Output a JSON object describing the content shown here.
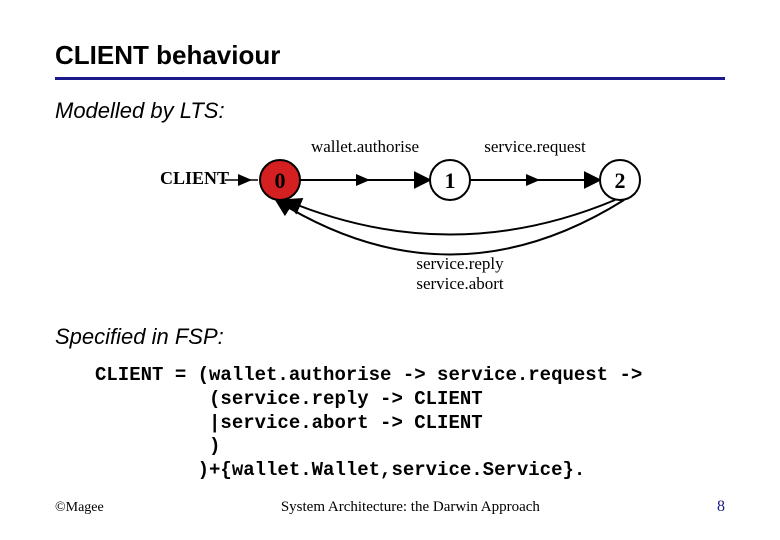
{
  "title": "CLIENT behaviour",
  "section1": "Modelled by LTS:",
  "section2": "Specified in FSP:",
  "lts": {
    "client_label": "CLIENT",
    "states": [
      "0",
      "1",
      "2"
    ],
    "edge01": "wallet.authorise",
    "edge12": "service.request",
    "edge20a": "service.reply",
    "edge20b": "service.abort"
  },
  "fsp": {
    "l1": "CLIENT = (wallet.authorise -> service.request ->",
    "l2": "          (service.reply -> CLIENT",
    "l3": "          |service.abort -> CLIENT",
    "l4": "          )",
    "l5": "         )+{wallet.Wallet,service.Service}."
  },
  "footer": {
    "copyright": "©Magee",
    "title": "System Architecture: the Darwin Approach",
    "page": "8"
  }
}
